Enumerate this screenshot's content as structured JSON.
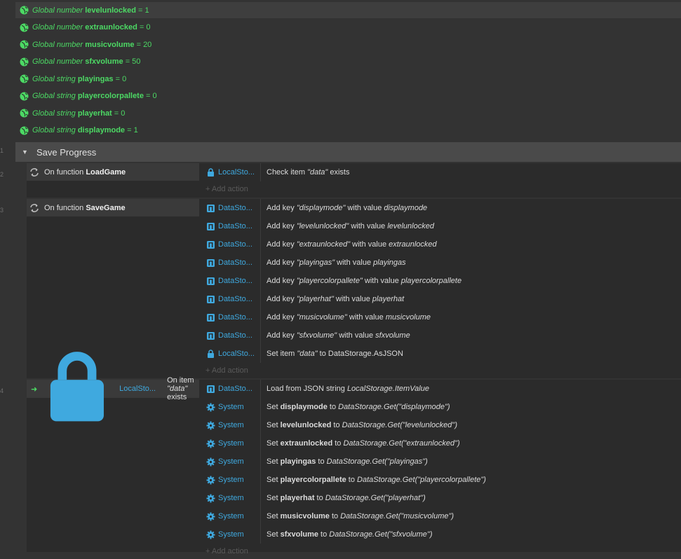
{
  "globals": [
    {
      "type": "Global number",
      "name": "levelunlocked",
      "value": "= 1"
    },
    {
      "type": "Global number",
      "name": "extraunlocked",
      "value": "= 0"
    },
    {
      "type": "Global number",
      "name": "musicvolume",
      "value": "= 20"
    },
    {
      "type": "Global number",
      "name": "sfxvolume",
      "value": "= 50"
    },
    {
      "type": "Global string",
      "name": "playingas",
      "value": "= 0"
    },
    {
      "type": "Global string",
      "name": "playercolorpallete",
      "value": "= 0"
    },
    {
      "type": "Global string",
      "name": "playerhat",
      "value": "= 0"
    },
    {
      "type": "Global string",
      "name": "displaymode",
      "value": "= 1"
    }
  ],
  "line_numbers": {
    "l1": "1",
    "l2": "2",
    "l3": "3",
    "l4": "4"
  },
  "group": {
    "title": "Save Progress"
  },
  "add_action_label": "+ Add action",
  "events": {
    "load": {
      "cond_prefix": "On function ",
      "cond_name": "LoadGame",
      "actions": [
        {
          "obj": "LocalSto...",
          "icon": "lock",
          "parts": [
            [
              "Check item ",
              "n"
            ],
            [
              "\"data\"",
              "i"
            ],
            [
              " exists",
              "n"
            ]
          ]
        }
      ]
    },
    "save": {
      "cond_prefix": "On function ",
      "cond_name": "SaveGame",
      "actions": [
        {
          "obj": "DataSto...",
          "icon": "data",
          "parts": [
            [
              "Add key ",
              "n"
            ],
            [
              "\"displaymode\"",
              "i"
            ],
            [
              " with value ",
              "n"
            ],
            [
              "displaymode",
              "i"
            ]
          ]
        },
        {
          "obj": "DataSto...",
          "icon": "data",
          "parts": [
            [
              "Add key ",
              "n"
            ],
            [
              "\"levelunlocked\"",
              "i"
            ],
            [
              " with value ",
              "n"
            ],
            [
              "levelunlocked",
              "i"
            ]
          ]
        },
        {
          "obj": "DataSto...",
          "icon": "data",
          "parts": [
            [
              "Add key ",
              "n"
            ],
            [
              "\"extraunlocked\"",
              "i"
            ],
            [
              " with value ",
              "n"
            ],
            [
              "extraunlocked",
              "i"
            ]
          ]
        },
        {
          "obj": "DataSto...",
          "icon": "data",
          "parts": [
            [
              "Add key ",
              "n"
            ],
            [
              "\"playingas\"",
              "i"
            ],
            [
              " with value ",
              "n"
            ],
            [
              "playingas",
              "i"
            ]
          ]
        },
        {
          "obj": "DataSto...",
          "icon": "data",
          "parts": [
            [
              "Add key ",
              "n"
            ],
            [
              "\"playercolorpallete\"",
              "i"
            ],
            [
              " with value ",
              "n"
            ],
            [
              "playercolorpallete",
              "i"
            ]
          ]
        },
        {
          "obj": "DataSto...",
          "icon": "data",
          "parts": [
            [
              "Add key ",
              "n"
            ],
            [
              "\"playerhat\"",
              "i"
            ],
            [
              " with value ",
              "n"
            ],
            [
              "playerhat",
              "i"
            ]
          ]
        },
        {
          "obj": "DataSto...",
          "icon": "data",
          "parts": [
            [
              "Add key ",
              "n"
            ],
            [
              "\"musicvolume\"",
              "i"
            ],
            [
              " with value ",
              "n"
            ],
            [
              "musicvolume",
              "i"
            ]
          ]
        },
        {
          "obj": "DataSto...",
          "icon": "data",
          "parts": [
            [
              "Add key ",
              "n"
            ],
            [
              "\"sfxvolume\"",
              "i"
            ],
            [
              " with value ",
              "n"
            ],
            [
              "sfxvolume",
              "i"
            ]
          ]
        },
        {
          "obj": "LocalSto...",
          "icon": "lock",
          "parts": [
            [
              "Set item ",
              "n"
            ],
            [
              "\"data\"",
              "i"
            ],
            [
              " to DataStorage.AsJSON",
              "n"
            ]
          ]
        }
      ]
    },
    "exists": {
      "trigger_obj": "LocalSto...",
      "cond_parts": [
        [
          "On item ",
          "n"
        ],
        [
          "\"data\"",
          "i"
        ],
        [
          " exists",
          "n"
        ]
      ],
      "actions": [
        {
          "obj": "DataSto...",
          "icon": "data",
          "parts": [
            [
              "Load from JSON string ",
              "n"
            ],
            [
              "LocalStorage.ItemValue",
              "i"
            ]
          ]
        },
        {
          "obj": "System",
          "icon": "gear",
          "parts": [
            [
              "Set ",
              "n"
            ],
            [
              "displaymode",
              "b"
            ],
            [
              " to ",
              "n"
            ],
            [
              "DataStorage.Get(\"displaymode\")",
              "i"
            ]
          ]
        },
        {
          "obj": "System",
          "icon": "gear",
          "parts": [
            [
              "Set ",
              "n"
            ],
            [
              "levelunlocked",
              "b"
            ],
            [
              " to ",
              "n"
            ],
            [
              "DataStorage.Get(\"levelunlocked\")",
              "i"
            ]
          ]
        },
        {
          "obj": "System",
          "icon": "gear",
          "parts": [
            [
              "Set ",
              "n"
            ],
            [
              "extraunlocked",
              "b"
            ],
            [
              " to ",
              "n"
            ],
            [
              "DataStorage.Get(\"extraunlocked\")",
              "i"
            ]
          ]
        },
        {
          "obj": "System",
          "icon": "gear",
          "parts": [
            [
              "Set ",
              "n"
            ],
            [
              "playingas",
              "b"
            ],
            [
              " to ",
              "n"
            ],
            [
              "DataStorage.Get(\"playingas\")",
              "i"
            ]
          ]
        },
        {
          "obj": "System",
          "icon": "gear",
          "parts": [
            [
              "Set ",
              "n"
            ],
            [
              "playercolorpallete",
              "b"
            ],
            [
              " to ",
              "n"
            ],
            [
              "DataStorage.Get(\"playercolorpallete\")",
              "i"
            ]
          ]
        },
        {
          "obj": "System",
          "icon": "gear",
          "parts": [
            [
              "Set ",
              "n"
            ],
            [
              "playerhat",
              "b"
            ],
            [
              " to ",
              "n"
            ],
            [
              "DataStorage.Get(\"playerhat\")",
              "i"
            ]
          ]
        },
        {
          "obj": "System",
          "icon": "gear",
          "parts": [
            [
              "Set ",
              "n"
            ],
            [
              "musicvolume",
              "b"
            ],
            [
              " to ",
              "n"
            ],
            [
              "DataStorage.Get(\"musicvolume\")",
              "i"
            ]
          ]
        },
        {
          "obj": "System",
          "icon": "gear",
          "parts": [
            [
              "Set ",
              "n"
            ],
            [
              "sfxvolume",
              "b"
            ],
            [
              " to ",
              "n"
            ],
            [
              "DataStorage.Get(\"sfxvolume\")",
              "i"
            ]
          ]
        }
      ]
    }
  },
  "colors": {
    "global_green": "#4cd964",
    "object_blue": "#3fa9df",
    "background": "#333333"
  }
}
